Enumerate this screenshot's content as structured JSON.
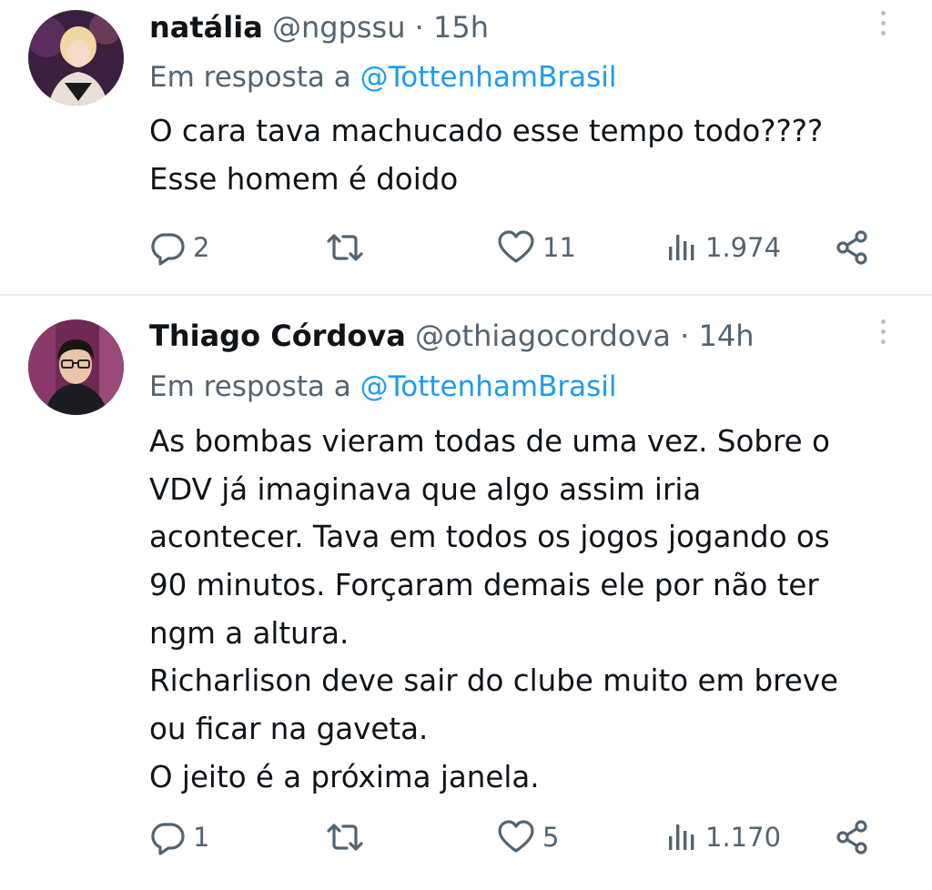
{
  "tweets": [
    {
      "name": "natália",
      "handle": "@ngpssu",
      "separator": "·",
      "time": "15h",
      "reply_prefix": "Em resposta a",
      "reply_to": "@TottenhamBrasil",
      "lines": [
        "O cara tava machucado esse tempo todo????",
        "Esse homem é doido"
      ],
      "replies": "2",
      "retweets": "",
      "likes": "11",
      "views": "1.974"
    },
    {
      "name": "Thiago Córdova",
      "handle": "@othiagocordova",
      "separator": "·",
      "time": "14h",
      "reply_prefix": "Em resposta a",
      "reply_to": "@TottenhamBrasil",
      "lines": [
        "As bombas vieram todas de uma vez. Sobre o",
        "VDV já imaginava que algo assim iria",
        "acontecer. Tava em todos os jogos jogando os",
        "90 minutos. Forçaram demais ele por não ter",
        "ngm a altura.",
        "Richarlison deve sair do clube muito em breve",
        "ou ficar na gaveta.",
        "O jeito é a próxima janela."
      ],
      "replies": "1",
      "retweets": "",
      "likes": "5",
      "views": "1.170"
    }
  ],
  "colors": {
    "text": "#0f1419",
    "secondary": "#536471",
    "link": "#1d9bf0",
    "divider": "#e8ebed"
  },
  "icons": [
    "reply-icon",
    "retweet-icon",
    "like-icon",
    "views-icon",
    "share-icon",
    "more-icon"
  ]
}
